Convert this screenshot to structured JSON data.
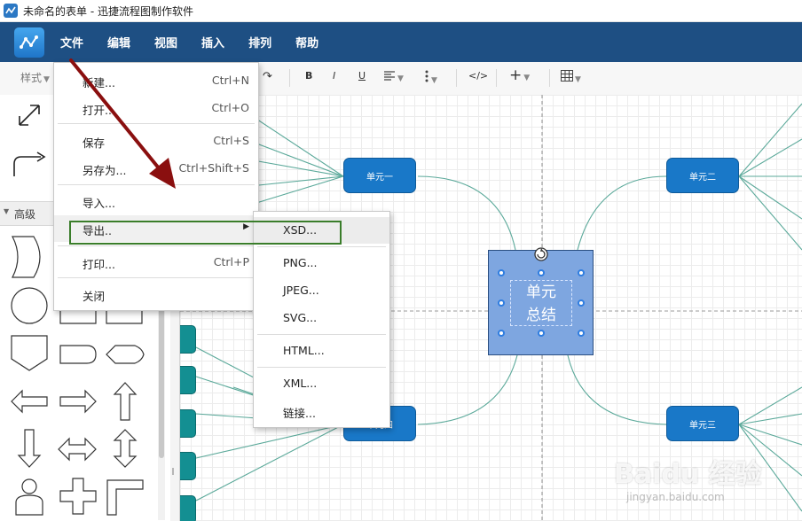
{
  "window": {
    "title": "未命名的表单 - 迅捷流程图制作软件"
  },
  "menubar": {
    "items": [
      "文件",
      "编辑",
      "视图",
      "插入",
      "排列",
      "帮助"
    ]
  },
  "toolbar": {
    "style_label": "样式",
    "bold": "B",
    "italic": "I",
    "underline": "U",
    "html_tag": "</>",
    "plus": "+",
    "redo": "↷"
  },
  "sidebar": {
    "section_label": "高级"
  },
  "file_menu": {
    "items": [
      {
        "label": "新建...",
        "shortcut": "Ctrl+N"
      },
      {
        "label": "打开...",
        "shortcut": "Ctrl+O"
      },
      {
        "label": "保存",
        "shortcut": "Ctrl+S"
      },
      {
        "label": "另存为...",
        "shortcut": "Ctrl+Shift+S"
      },
      {
        "label": "导入...",
        "shortcut": ""
      },
      {
        "label": "导出..",
        "shortcut": ""
      },
      {
        "label": "打印...",
        "shortcut": "Ctrl+P"
      },
      {
        "label": "关闭",
        "shortcut": ""
      }
    ]
  },
  "export_submenu": {
    "items": [
      "XSD...",
      "PNG...",
      "JPEG...",
      "SVG...",
      "HTML...",
      "XML...",
      "链接..."
    ]
  },
  "canvas": {
    "nodes": {
      "unit1": "单元一",
      "unit2": "单元二",
      "unit3": "单元三",
      "unit4": "单元四"
    },
    "center": {
      "line1": "单元",
      "line2": "总结"
    }
  },
  "watermark": {
    "main": "Baidu 经验",
    "sub": "jingyan.baidu.com"
  },
  "colors": {
    "menubar_bg": "#1e4f83",
    "node_blue": "#1978c8",
    "teal": "#138f92",
    "center_fill": "#7ea6e0",
    "connector": "#5ba99a",
    "highlight_green": "#3a7d2a",
    "arrow_red": "#8a0f0f"
  }
}
